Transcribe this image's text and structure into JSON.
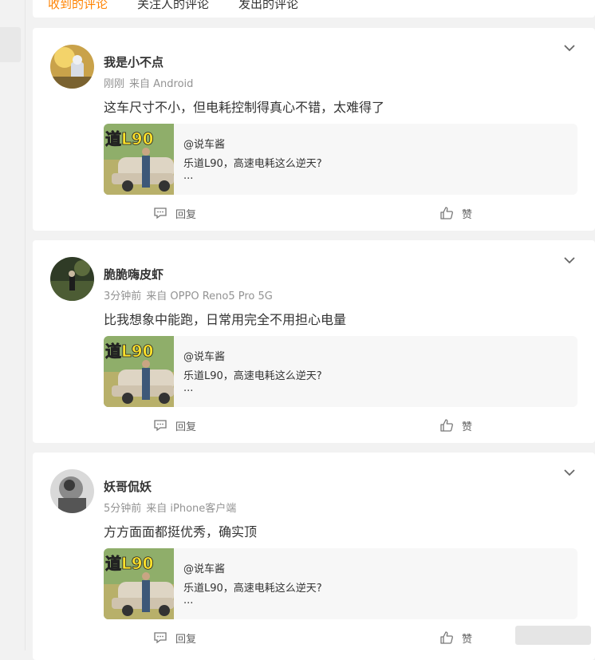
{
  "tabs": [
    {
      "label": "收到的评论",
      "active": true
    },
    {
      "label": "关注人的评论",
      "active": false
    },
    {
      "label": "发出的评论",
      "active": false
    }
  ],
  "colors": {
    "accent": "#ff8200",
    "text": "#333333",
    "meta": "#939393",
    "card_bg": "#ffffff",
    "quote_bg": "#f7f7f7"
  },
  "actions": {
    "reply_label": "回复",
    "like_label": "赞",
    "reply_icon": "comment-icon",
    "like_icon": "thumbs-up-icon",
    "more_icon": "chevron-down-icon"
  },
  "comments": [
    {
      "username": "我是小不点",
      "time": "刚刚",
      "source": "来自 Android",
      "text": "这车尺寸不小，但电耗控制得真心不错，太难得了",
      "quote": {
        "author": "@说车酱",
        "title": "乐道L90，高速电耗这么逆天?",
        "more": "...",
        "thumb_text": "道L90"
      }
    },
    {
      "username": "脆脆嗨皮虾",
      "time": "3分钟前",
      "source": "来自 OPPO Reno5 Pro 5G",
      "text": "比我想象中能跑，日常用完全不用担心电量",
      "quote": {
        "author": "@说车酱",
        "title": "乐道L90，高速电耗这么逆天?",
        "more": "...",
        "thumb_text": "道L90"
      }
    },
    {
      "username": "妖哥侃妖",
      "time": "5分钟前",
      "source": "来自 iPhone客户端",
      "text": "方方面面都挺优秀，确实顶",
      "quote": {
        "author": "@说车酱",
        "title": "乐道L90，高速电耗这么逆天?",
        "more": "...",
        "thumb_text": "道L90"
      }
    }
  ]
}
